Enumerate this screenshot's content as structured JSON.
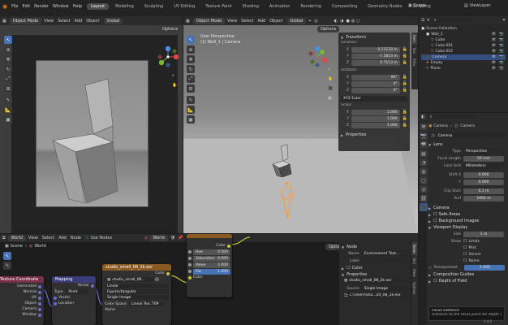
{
  "topbar": {
    "menus": [
      "File",
      "Edit",
      "Render",
      "Window",
      "Help"
    ],
    "workspaces": [
      "Layout",
      "Modeling",
      "Sculpting",
      "UV Editing",
      "Texture Paint",
      "Shading",
      "Animation",
      "Rendering",
      "Compositing",
      "Geometry Nodes",
      "Scripting"
    ],
    "active_workspace": "Layout",
    "scene": "Scene",
    "view_layer": "ViewLayer"
  },
  "left_viewport": {
    "mode": "Object Mode",
    "menus": [
      "View",
      "Select",
      "Add",
      "Object"
    ],
    "orientation": "Global",
    "options": "Options"
  },
  "main_viewport": {
    "mode": "Object Mode",
    "menus": [
      "View",
      "Select",
      "Add",
      "Object"
    ],
    "orientation": "Global",
    "options": "Options",
    "view_name": "User Perspective",
    "view_sub": "(1) Wall_1 | Camera"
  },
  "transform_panel": {
    "title": "Transform",
    "location_label": "Location:",
    "location": [
      {
        "axis": "X",
        "value": "0.11133 m"
      },
      {
        "axis": "Y",
        "value": "-7.5853 m"
      },
      {
        "axis": "Z",
        "value": "0.7113 m"
      }
    ],
    "rotation_label": "Rotation:",
    "rotation": [
      {
        "axis": "X",
        "value": "90°"
      },
      {
        "axis": "Y",
        "value": "0°"
      },
      {
        "axis": "Z",
        "value": "0°"
      }
    ],
    "euler": "XYZ Euler",
    "scale_label": "Scale:",
    "scale": [
      {
        "axis": "X",
        "value": "1.000"
      },
      {
        "axis": "Y",
        "value": "1.000"
      },
      {
        "axis": "Z",
        "value": "1.000"
      }
    ],
    "properties": "Properties",
    "tabs": [
      "Item",
      "Tool",
      "View"
    ]
  },
  "outliner": {
    "root": "Scene Collection",
    "items": [
      {
        "name": "Wall_1",
        "indent": 1
      },
      {
        "name": "Cube",
        "indent": 2
      },
      {
        "name": "Cube.001",
        "indent": 2
      },
      {
        "name": "Cube.002",
        "indent": 2
      },
      {
        "name": "Camera",
        "indent": 1
      },
      {
        "name": "Empty",
        "indent": 1
      },
      {
        "name": "Plane",
        "indent": 1
      }
    ]
  },
  "props": {
    "breadcrumb_obj": "Camera",
    "breadcrumb_data": "Camera",
    "data_name": "Camera",
    "lens_section": "Lens",
    "type_label": "Type",
    "type_value": "Perspective",
    "focal_label": "Focal Length",
    "focal_value": "50 mm",
    "lens_unit_label": "Lens Unit",
    "lens_unit_value": "Millimeters",
    "shift_x_label": "Shift X",
    "shift_x_value": "0.000",
    "shift_y_label": "Y",
    "shift_y_value": "0.000",
    "clip_start_label": "Clip Start",
    "clip_start_value": "0.1 m",
    "clip_end_label": "End",
    "clip_end_value": "1000 m",
    "sections": [
      "Camera",
      "Safe Areas",
      "Background Images"
    ],
    "viewport_display": "Viewport Display",
    "size_label": "Size",
    "size_value": "1 m",
    "show_label": "Show",
    "show_options": [
      "Limits",
      "Mist",
      "Sensor",
      "Name"
    ],
    "passepartout_label": "Passepartout",
    "passepartout_value": "1.000",
    "comp_guides": "Composition Guides",
    "dof": "Depth of Field",
    "tooltip_title": "Focus Distance",
    "tooltip_text": "Distance to the focus point for depth of field"
  },
  "node_editor": {
    "type": "World",
    "menus": [
      "View",
      "Select",
      "Add",
      "Node"
    ],
    "use_nodes": "Use Nodes",
    "world_name": "World",
    "breadcrumb": [
      "Scene",
      "World"
    ],
    "options": "Options"
  },
  "nodes": {
    "texcoord": {
      "title": "Texture Coordinate",
      "outputs": [
        "Generated",
        "Normal",
        "UV",
        "Object",
        "Camera",
        "Window"
      ]
    },
    "mapping": {
      "title": "Mapping",
      "output": "Vector",
      "type_label": "Type",
      "type_value": "Point",
      "input": "Vector",
      "location": "Location"
    },
    "envtex": {
      "title": "studio_small_08_2k.exr",
      "output": "Color",
      "image": "studio_small_08...",
      "interp": "Linear",
      "proj": "Equirectangular",
      "ext": "Single Image",
      "colorspace_label": "Color Space",
      "colorspace": "Linear Rec.709",
      "alpha_label": "Alpha",
      "vector": "Vector"
    },
    "hsv": {
      "output": "Color",
      "fields": [
        {
          "label": "Hue",
          "value": "0.500"
        },
        {
          "label": "Saturation",
          "value": "0.000"
        },
        {
          "label": "Value",
          "value": "2.000"
        },
        {
          "label": "Fac",
          "value": "1.000"
        }
      ],
      "input": "Color"
    }
  },
  "node_sidebar": {
    "node_section": "Node",
    "name_label": "Name",
    "name_value": "Environment Text...",
    "label_label": "Label",
    "label_value": "",
    "color_section": "Color",
    "properties_section": "Properties",
    "image_name": "studio_small_08_2k.exr",
    "source_label": "Source",
    "source_value": "Single Image",
    "filepath": "C:\\Users\\Sha...ult_08_2k.exr",
    "tabs": [
      "Node",
      "Tool",
      "View",
      "Options"
    ]
  },
  "statusbar": {
    "version": "3.4.0"
  },
  "colors": {
    "accent": "#4772b3",
    "selected_orange": "#f0a040",
    "camera_orange": "#e89a2c"
  }
}
